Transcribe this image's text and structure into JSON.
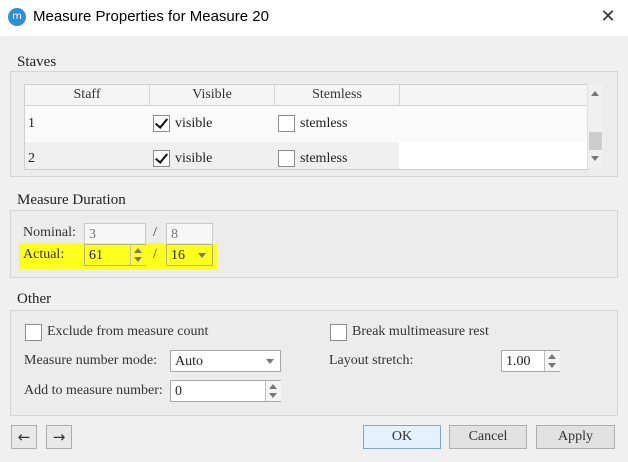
{
  "window": {
    "title": "Measure Properties for Measure 20",
    "app_icon": "musescore-icon"
  },
  "staves": {
    "section_title": "Staves",
    "columns": [
      "Staff",
      "Visible",
      "Stemless"
    ],
    "rows": [
      {
        "staff": "1",
        "visible_label": "visible",
        "visible_checked": true,
        "stemless_label": "stemless",
        "stemless_checked": false
      },
      {
        "staff": "2",
        "visible_label": "visible",
        "visible_checked": true,
        "stemless_label": "stemless",
        "stemless_checked": false
      }
    ]
  },
  "duration": {
    "section_title": "Measure Duration",
    "nominal_label": "Nominal:",
    "nominal_numerator": "3",
    "nominal_denominator": "8",
    "actual_label": "Actual:",
    "actual_numerator": "61",
    "actual_denominator": "16",
    "separator": "/",
    "highlight_color": "#ffff1e"
  },
  "other": {
    "section_title": "Other",
    "exclude_label": "Exclude from measure count",
    "break_label": "Break multimeasure rest",
    "number_mode_label": "Measure number mode:",
    "number_mode_value": "Auto",
    "layout_stretch_label": "Layout stretch:",
    "layout_stretch_value": "1.00",
    "add_number_label": "Add to measure number:",
    "add_number_value": "0"
  },
  "buttons": {
    "prev": "←",
    "next": "→",
    "ok": "OK",
    "cancel": "Cancel",
    "apply": "Apply"
  }
}
